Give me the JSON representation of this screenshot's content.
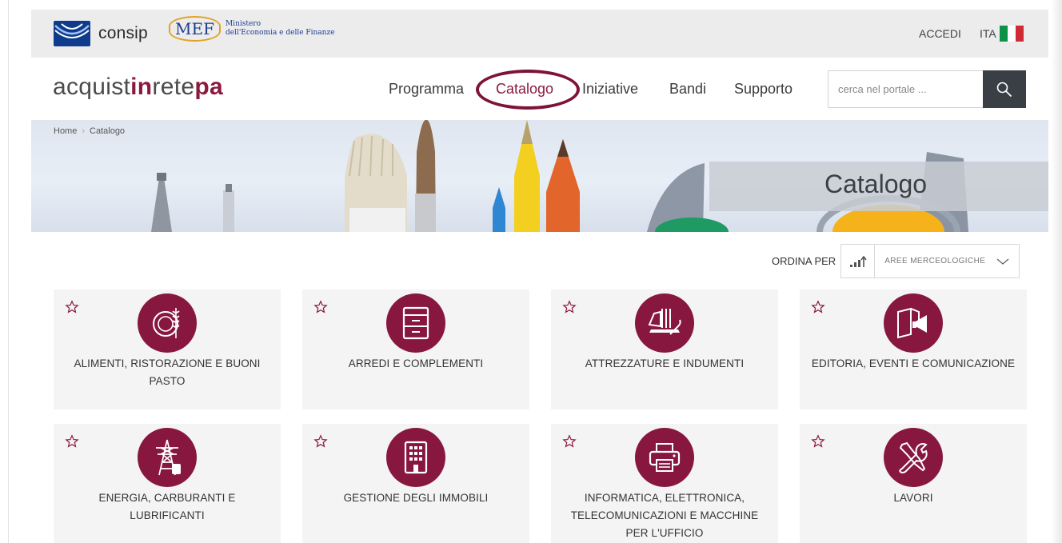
{
  "topbar": {
    "consip_label": "consip",
    "mef_mark": "MEF",
    "mef_line1": "Ministero",
    "mef_line2": "dell'Economia e delle Finanze",
    "login_label": "ACCEDI",
    "language_label": "ITA",
    "flag_colors": [
      "#0b9246",
      "#ffffff",
      "#cf2b37"
    ]
  },
  "brand": {
    "part1": "acquist",
    "part2": "in",
    "part3": "rete",
    "part4": "pa"
  },
  "nav": {
    "items": [
      {
        "label": "Programma"
      },
      {
        "label": "Catalogo",
        "active": true
      },
      {
        "label": "Iniziative"
      },
      {
        "label": "Bandi"
      },
      {
        "label": "Supporto"
      }
    ]
  },
  "search": {
    "placeholder": "cerca nel portale ..."
  },
  "breadcrumb": {
    "home": "Home",
    "current": "Catalogo"
  },
  "hero": {
    "title": "Catalogo"
  },
  "sort": {
    "label": "ORDINA PER",
    "selected": "AREE MERCEOLOGICHE"
  },
  "categories": [
    {
      "label": "ALIMENTI, RISTORAZIONE E BUONI PASTO",
      "icon": "food-icon"
    },
    {
      "label": "ARREDI E COMPLEMENTI",
      "icon": "cabinet-icon"
    },
    {
      "label": "ATTREZZATURE E INDUMENTI",
      "icon": "tools-clothing-icon"
    },
    {
      "label": "EDITORIA, EVENTI E COMUNICAZIONE",
      "icon": "megaphone-book-icon"
    },
    {
      "label": "ENERGIA, CARBURANTI E LUBRIFICANTI",
      "icon": "power-tower-icon"
    },
    {
      "label": "GESTIONE DEGLI IMMOBILI",
      "icon": "building-icon"
    },
    {
      "label": "INFORMATICA, ELETTRONICA, TELECOMUNICAZIONI E MACCHINE PER L'UFFICIO",
      "icon": "printer-icon"
    },
    {
      "label": "LAVORI",
      "icon": "wrench-screwdriver-icon"
    }
  ],
  "colors": {
    "brand": "#8b1a3e",
    "icon_bg": "#87173f",
    "card_bg": "#f4f4f4",
    "topbar_bg": "#ececec",
    "search_btn": "#3a3f46"
  }
}
